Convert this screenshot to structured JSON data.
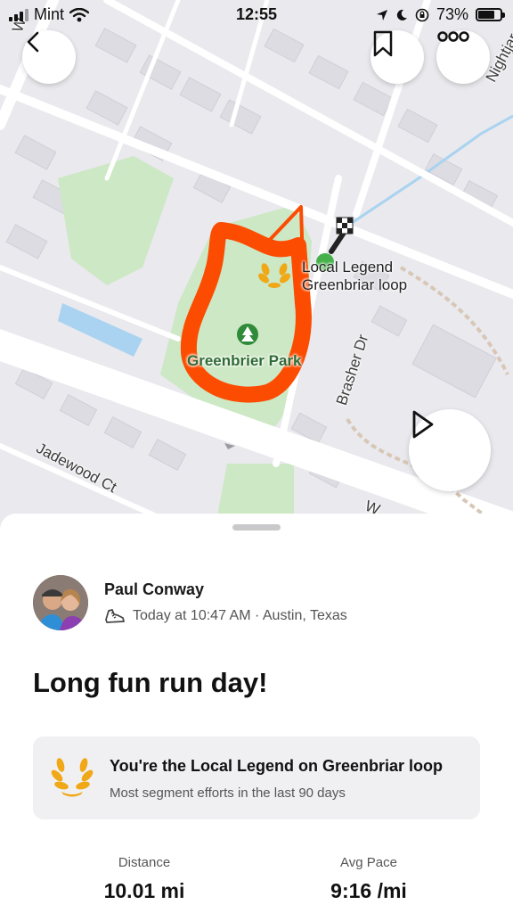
{
  "status_bar": {
    "carrier": "Mint",
    "time": "12:55",
    "battery_percent": "73%",
    "battery_level": 0.73,
    "icons": [
      "cellular-signal-icon",
      "wifi-icon",
      "location-arrow-icon",
      "moon-icon",
      "orientation-lock-icon",
      "battery-icon"
    ]
  },
  "map": {
    "labels": {
      "park": "Greenbrier Park",
      "local_legend_line1": "Local Legend",
      "local_legend_line2": "Greenbriar loop",
      "street_brasher": "Brasher Dr",
      "street_jadewood": "Jadewood Ct",
      "street_nightjar": "Nightjar",
      "street_top_left": "W",
      "street_bottom": "W"
    },
    "buttons": {
      "back": "back-icon",
      "save": "bookmark-icon",
      "more": "more-icon",
      "play": "play-icon"
    },
    "colors": {
      "route": "#fc4c02",
      "park": "#cde8c4",
      "water": "#a9d3f0",
      "start_marker": "#46b14a"
    }
  },
  "activity": {
    "athlete_name": "Paul Conway",
    "activity_type_icon": "run-shoe-icon",
    "meta": "Today at 10:47 AM · Austin, Texas",
    "title": "Long fun run day!",
    "local_legend": {
      "icon": "laurel-icon",
      "title": "You're the Local Legend on Greenbriar loop",
      "subtitle": "Most segment efforts in the last 90 days",
      "color": "#f0a817"
    },
    "stats": [
      {
        "label": "Distance",
        "value": "10.01 mi"
      },
      {
        "label": "Avg Pace",
        "value": "9:16 /mi"
      }
    ]
  }
}
